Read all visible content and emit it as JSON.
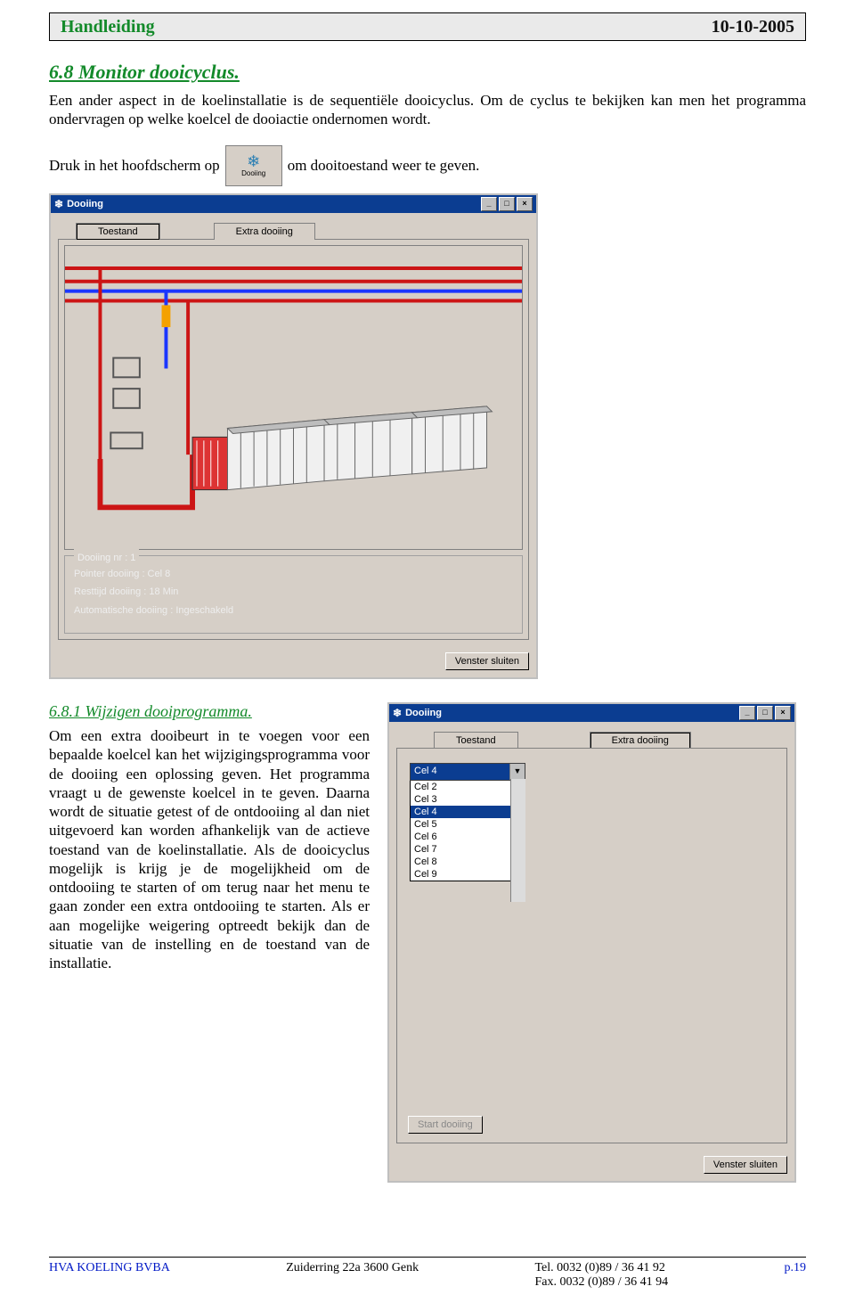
{
  "header": {
    "title": "Handleiding",
    "date": "10-10-2005"
  },
  "section": {
    "h68": "6.8  Monitor dooicyclus.",
    "p1": "Een ander aspect in de koelinstallatie is de sequentiële dooicyclus. Om de cyclus te bekijken kan men het programma ondervragen op welke koelcel de dooiactie ondernomen wordt.",
    "line2a": "Druk in het hoofdscherm op",
    "line2b": "om dooitoestand weer te geven.",
    "btn_label": "Dooiing"
  },
  "win1": {
    "title": "Dooiing",
    "tabs": {
      "t1": "Toestand",
      "t2": "Extra dooiing"
    },
    "fs_legend": "Dooiing nr : 1",
    "p_pointer": "Pointer dooiing   : Cel 8",
    "p_rest": "Resttijd dooiing   : 18 Min",
    "p_auto": "Automatische dooiing  : Ingeschakeld",
    "close": "Venster sluiten"
  },
  "section2": {
    "h681": "6.8.1  Wijzigen dooiprogramma.",
    "p": "Om een extra dooibeurt in te voegen voor een bepaalde koelcel kan het wijzigingsprogramma voor de dooiing een oplossing geven. Het programma vraagt u de gewenste koelcel in te geven. Daarna wordt de situatie getest of de ontdooiing al dan niet uitgevoerd kan worden afhankelijk van de actieve toestand van de koelinstallatie. Als de dooicyclus mogelijk is krijg je de mogelijkheid om de ontdooiing te starten of om terug naar het menu te gaan zonder een extra ontdooiing te starten. Als er aan mogelijke weigering optreedt bekijk dan de situatie van de instelling en de toestand van de installatie."
  },
  "win2": {
    "title": "Dooiing",
    "tabs": {
      "t1": "Toestand",
      "t2": "Extra dooiing"
    },
    "selected": "Cel 4",
    "options": [
      "Cel 2",
      "Cel 3",
      "Cel 4",
      "Cel 5",
      "Cel 6",
      "Cel 7",
      "Cel 8",
      "Cel 9"
    ],
    "start": "Start dooiing",
    "close": "Venster sluiten"
  },
  "footer": {
    "company": "HVA KOELING BVBA",
    "addr": "Zuiderring 22a  3600 Genk",
    "tel1": "Tel. 0032 (0)89 / 36 41 92",
    "tel2": "Fax. 0032 (0)89 / 36 41 94",
    "page": "p.19"
  }
}
